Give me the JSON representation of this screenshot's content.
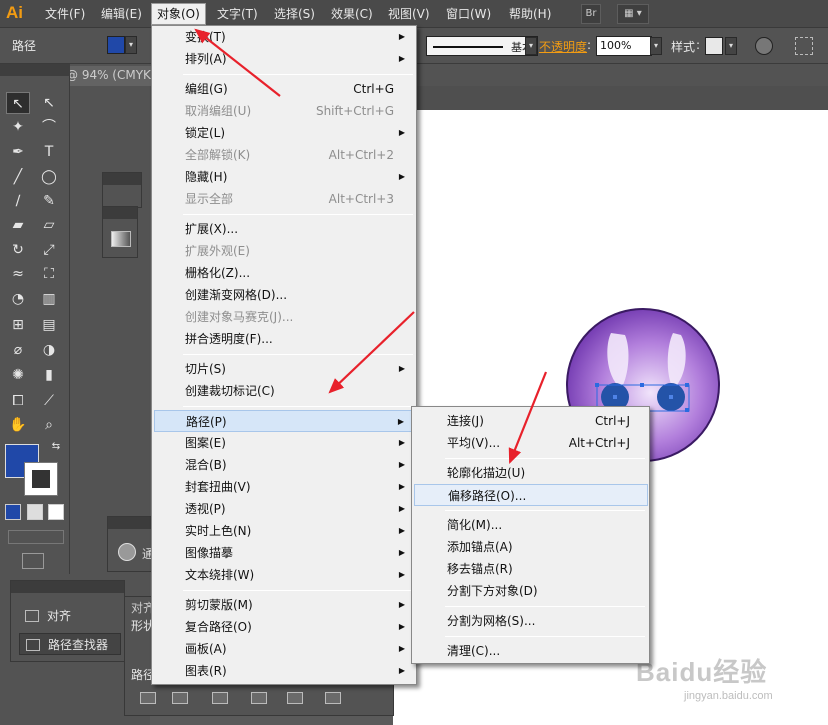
{
  "app": {
    "logo": "Ai",
    "menubar": [
      "文件(F)",
      "编辑(E)",
      "对象(O)",
      "文字(T)",
      "选择(S)",
      "效果(C)",
      "视图(V)",
      "窗口(W)",
      "帮助(H)"
    ],
    "bridge_button": "Br"
  },
  "control_bar": {
    "object_type": "路径",
    "stroke_profile": "基本",
    "opacity_label": "不透明度",
    "opacity_value": "100%",
    "style_label": "样式",
    "fill_color": "#2048a8"
  },
  "document": {
    "tab_title": "@ 94% (CMYK"
  },
  "object_menu": {
    "items": [
      {
        "label": "变换(T)",
        "shortcut": "",
        "submenu": true,
        "disabled": false
      },
      {
        "label": "排列(A)",
        "shortcut": "",
        "submenu": true,
        "disabled": false
      },
      {
        "label": "编组(G)",
        "shortcut": "Ctrl+G",
        "submenu": false,
        "disabled": false
      },
      {
        "label": "取消编组(U)",
        "shortcut": "Shift+Ctrl+G",
        "submenu": false,
        "disabled": true
      },
      {
        "label": "锁定(L)",
        "shortcut": "",
        "submenu": true,
        "disabled": false
      },
      {
        "label": "全部解锁(K)",
        "shortcut": "Alt+Ctrl+2",
        "submenu": false,
        "disabled": true
      },
      {
        "label": "隐藏(H)",
        "shortcut": "",
        "submenu": true,
        "disabled": false
      },
      {
        "label": "显示全部",
        "shortcut": "Alt+Ctrl+3",
        "submenu": false,
        "disabled": true
      },
      {
        "label": "扩展(X)...",
        "shortcut": "",
        "submenu": false,
        "disabled": false
      },
      {
        "label": "扩展外观(E)",
        "shortcut": "",
        "submenu": false,
        "disabled": true
      },
      {
        "label": "栅格化(Z)...",
        "shortcut": "",
        "submenu": false,
        "disabled": false
      },
      {
        "label": "创建渐变网格(D)...",
        "shortcut": "",
        "submenu": false,
        "disabled": false
      },
      {
        "label": "创建对象马赛克(J)...",
        "shortcut": "",
        "submenu": false,
        "disabled": true
      },
      {
        "label": "拼合透明度(F)...",
        "shortcut": "",
        "submenu": false,
        "disabled": false
      },
      {
        "label": "切片(S)",
        "shortcut": "",
        "submenu": true,
        "disabled": false
      },
      {
        "label": "创建裁切标记(C)",
        "shortcut": "",
        "submenu": false,
        "disabled": false
      },
      {
        "label": "路径(P)",
        "shortcut": "",
        "submenu": true,
        "disabled": false
      },
      {
        "label": "图案(E)",
        "shortcut": "",
        "submenu": true,
        "disabled": false
      },
      {
        "label": "混合(B)",
        "shortcut": "",
        "submenu": true,
        "disabled": false
      },
      {
        "label": "封套扭曲(V)",
        "shortcut": "",
        "submenu": true,
        "disabled": false
      },
      {
        "label": "透视(P)",
        "shortcut": "",
        "submenu": true,
        "disabled": false
      },
      {
        "label": "实时上色(N)",
        "shortcut": "",
        "submenu": true,
        "disabled": false
      },
      {
        "label": "图像描摹",
        "shortcut": "",
        "submenu": true,
        "disabled": false
      },
      {
        "label": "文本绕排(W)",
        "shortcut": "",
        "submenu": true,
        "disabled": false
      },
      {
        "label": "剪切蒙版(M)",
        "shortcut": "",
        "submenu": true,
        "disabled": false
      },
      {
        "label": "复合路径(O)",
        "shortcut": "",
        "submenu": true,
        "disabled": false
      },
      {
        "label": "画板(A)",
        "shortcut": "",
        "submenu": true,
        "disabled": false
      },
      {
        "label": "图表(R)",
        "shortcut": "",
        "submenu": true,
        "disabled": false
      }
    ]
  },
  "path_submenu": {
    "items": [
      {
        "label": "连接(J)",
        "shortcut": "Ctrl+J"
      },
      {
        "label": "平均(V)...",
        "shortcut": "Alt+Ctrl+J"
      },
      {
        "label": "轮廓化描边(U)",
        "shortcut": ""
      },
      {
        "label": "偏移路径(O)...",
        "shortcut": ""
      },
      {
        "label": "简化(M)...",
        "shortcut": ""
      },
      {
        "label": "添加锚点(A)",
        "shortcut": ""
      },
      {
        "label": "移去锚点(R)",
        "shortcut": ""
      },
      {
        "label": "分割下方对象(D)",
        "shortcut": ""
      },
      {
        "label": "分割为网格(S)...",
        "shortcut": ""
      },
      {
        "label": "清理(C)...",
        "shortcut": ""
      }
    ]
  },
  "panels": {
    "align_label": "对齐",
    "pathfinder_label": "路径查找器",
    "transform_tab": "对齐",
    "shape_mode_prefix": "形状",
    "pathfinder_prefix": "路径",
    "partial_text": "通"
  },
  "watermark": {
    "main": "Baidu经验",
    "sub": "jingyan.baidu.com"
  },
  "colors": {
    "accent_arrow": "#e8212b",
    "menu_highlight": "#d6e6f8",
    "art_purple": "#8a4fc4"
  }
}
